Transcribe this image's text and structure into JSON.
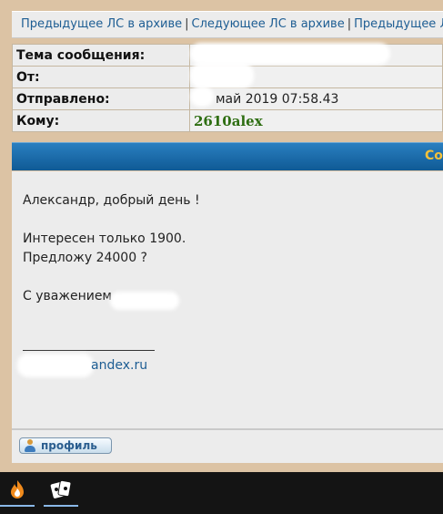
{
  "nav": {
    "links": [
      "Предыдущее ЛС в архиве",
      "Следующее ЛС в архиве",
      "Предыдущее ЛС"
    ],
    "separator": "|"
  },
  "info": {
    "subject_label": "Тема сообщения:",
    "subject_value": "",
    "from_label": "От:",
    "from_value": "",
    "sent_label": "Отправлено:",
    "sent_value": "май 2019 07:58.43",
    "to_label": "Кому:",
    "to_value": "2610alex"
  },
  "header_bar": {
    "text": "Со"
  },
  "message": {
    "line1": "Александр, добрый день !",
    "line2": "Интересен только 1900.",
    "line3": "Предложу 24000 ?",
    "line4": "С уважением",
    "email": "andex.ru"
  },
  "footer": {
    "profile_button": "профиль"
  },
  "taskbar": {
    "items": [
      "flame-app-icon",
      "cards-app-icon"
    ]
  }
}
